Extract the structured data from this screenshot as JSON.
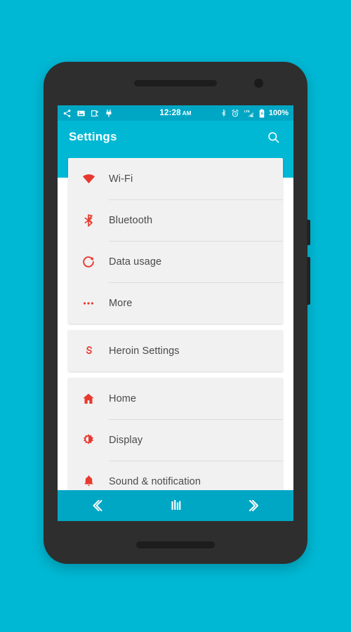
{
  "theme": {
    "background": "#00b8d4",
    "appbar": "#00b8d4",
    "statusbar": "#00a7c4",
    "navbar": "#00a7c4",
    "card": "#f1f1f1",
    "icon_red": "#e8392f",
    "text": "#4a4a4a",
    "phone_body": "#2e2e2e"
  },
  "statusbar": {
    "left_icons": [
      "share-icon",
      "image-icon",
      "screenshot-icon",
      "usb-plug-icon"
    ],
    "time": "12:28",
    "ampm": "AM",
    "right_icons": [
      "bluetooth-icon",
      "alarm-icon",
      "lte-signal-icon",
      "battery-icon"
    ],
    "battery_percent": "100%"
  },
  "appbar": {
    "title": "Settings",
    "search_icon": "search-icon"
  },
  "groups": [
    {
      "rows": [
        {
          "icon": "wifi-icon",
          "label": "Wi-Fi"
        },
        {
          "icon": "bluetooth-icon",
          "label": "Bluetooth"
        },
        {
          "icon": "data-usage-icon",
          "label": "Data usage"
        },
        {
          "icon": "more-dots-icon",
          "label": "More"
        }
      ]
    },
    {
      "rows": [
        {
          "icon": "heroin-s-icon",
          "label": "Heroin Settings"
        }
      ]
    },
    {
      "rows": [
        {
          "icon": "home-icon",
          "label": "Home"
        },
        {
          "icon": "display-icon",
          "label": "Display"
        },
        {
          "icon": "bell-icon",
          "label": "Sound & notification"
        }
      ]
    }
  ],
  "navbar": {
    "back_label": "back-chevron-icon",
    "home_label": "home-bars-icon",
    "recents_label": "recents-chevron-icon"
  }
}
